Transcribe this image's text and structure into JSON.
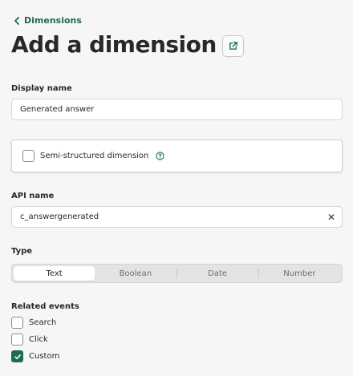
{
  "breadcrumb": {
    "label": "Dimensions"
  },
  "header": {
    "title": "Add a dimension",
    "external_icon": "external-link-icon"
  },
  "display_name": {
    "label": "Display name",
    "value": "Generated answer"
  },
  "semi_structured": {
    "label": "Semi-structured dimension",
    "checked": false,
    "help_icon": "help-circle-icon"
  },
  "api_name": {
    "label": "API name",
    "value": "c_answergenerated",
    "clear_symbol": "✕"
  },
  "type": {
    "label": "Type",
    "options": [
      "Text",
      "Boolean",
      "Date",
      "Number"
    ],
    "selected": "Text"
  },
  "related_events": {
    "label": "Related events",
    "items": [
      {
        "label": "Search",
        "checked": false
      },
      {
        "label": "Click",
        "checked": false
      },
      {
        "label": "Custom",
        "checked": true
      }
    ]
  },
  "colors": {
    "accent": "#1f6a57",
    "background": "#f6f6f6",
    "text": "#282829"
  }
}
